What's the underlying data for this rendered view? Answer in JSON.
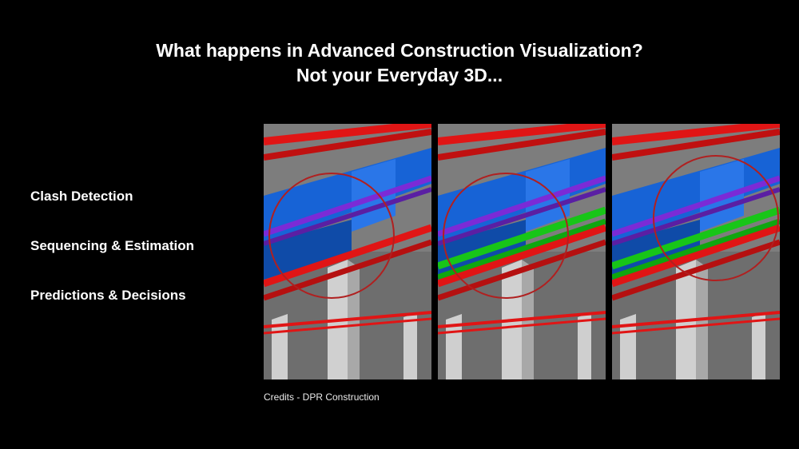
{
  "title_line1": "What happens in Advanced Construction Visualization?",
  "title_line2": "Not your Everyday 3D...",
  "bullets": {
    "b1": "Clash Detection",
    "b2": "Sequencing & Estimation",
    "b3": "Predictions & Decisions"
  },
  "credits": "Credits - DPR Construction",
  "colors": {
    "duct_blue": "#1763d6",
    "pipe_red": "#e01515",
    "pipe_purple": "#7b2bd6",
    "pipe_green": "#18c518",
    "ceiling": "#7d7d7d",
    "column": "#bfbfbf",
    "highlight": "#b02020"
  }
}
